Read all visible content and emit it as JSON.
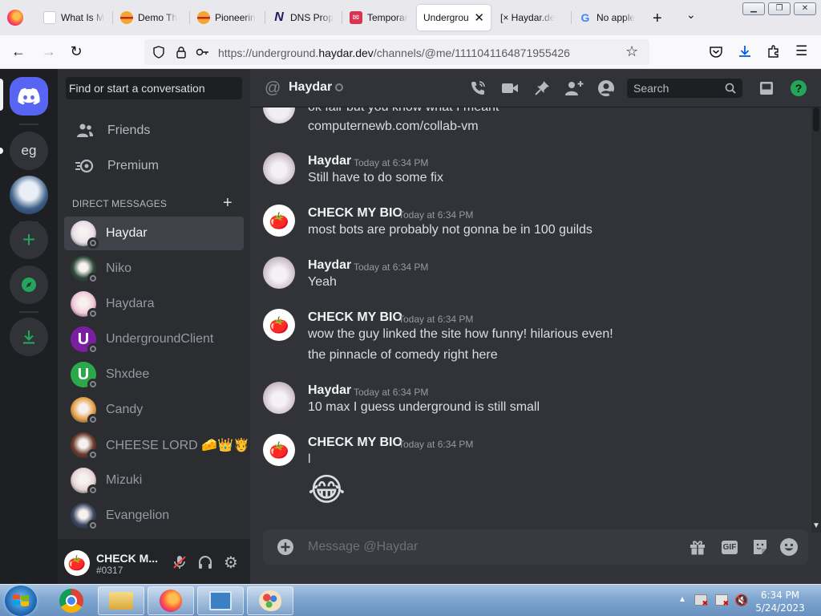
{
  "browser": {
    "tabs": [
      {
        "label": "What Is My IP",
        "favicon": "globe-icon"
      },
      {
        "label": "Demo Th",
        "favicon": "burger-icon"
      },
      {
        "label": "Pioneerin",
        "favicon": "burger-icon"
      },
      {
        "label": "DNS Prop",
        "favicon": "n-logo-icon"
      },
      {
        "label": "Temporar",
        "favicon": "mail-icon"
      },
      {
        "label": "Undergrou",
        "favicon": "discord-icon",
        "active": true
      },
      {
        "label": "[× Haydar.de",
        "favicon": "none"
      },
      {
        "label": "No apple",
        "favicon": "google-icon"
      }
    ],
    "url_prefix": "https://underground.",
    "url_host": "haydar.dev",
    "url_path": "/channels/@me/1111041164871955426"
  },
  "rail": {
    "server_text_icon": "eg"
  },
  "sidebar": {
    "search_placeholder": "Find or start a conversation",
    "links": [
      {
        "label": "Friends",
        "icon": "friends-icon"
      },
      {
        "label": "Premium",
        "icon": "nitro-icon"
      }
    ],
    "dm_header": "DIRECT MESSAGES",
    "dms": [
      {
        "name": "Haydar",
        "color": "#e9dfe6",
        "selected": true
      },
      {
        "name": "Niko",
        "color": "#2f4a3a"
      },
      {
        "name": "Haydara",
        "color": "#f3c9d8"
      },
      {
        "name": "UndergroundClient",
        "color": "#7a1fa2",
        "letter": "U"
      },
      {
        "name": "Shxdee",
        "color": "#2aa84a",
        "letter": "U"
      },
      {
        "name": "Candy",
        "color": "#e7a24a"
      },
      {
        "name": "CHEESE LORD 🧀👑🫅",
        "color": "#6b3a2b"
      },
      {
        "name": "Mizuki",
        "color": "#e8d6d6"
      },
      {
        "name": "Evangelion",
        "color": "#3b4660"
      }
    ],
    "user": {
      "name": "CHECK M...",
      "tag": "#0317"
    }
  },
  "chat": {
    "recipient": "Haydar",
    "search_placeholder": "Search",
    "composer_placeholder": "Message @Haydar",
    "partial_line_top": "ok fair but you know what I meant",
    "first_line": "computernewb.com/collab-vm",
    "messages": [
      {
        "author": "Haydar",
        "time": "Today at 6:34 PM",
        "lines": [
          "Still have to do some fix"
        ],
        "avatar": "haydar"
      },
      {
        "author": "CHECK MY BIO",
        "time": "Today at 6:34 PM",
        "lines": [
          "most bots are probably not gonna be in 100 guilds"
        ],
        "avatar": "bio"
      },
      {
        "author": "Haydar",
        "time": "Today at 6:34 PM",
        "lines": [
          "Yeah"
        ],
        "avatar": "haydar"
      },
      {
        "author": "CHECK MY BIO",
        "time": "Today at 6:34 PM",
        "lines": [
          "wow the guy linked the site how funny! hilarious even!",
          "the pinnacle of comedy right here"
        ],
        "avatar": "bio"
      },
      {
        "author": "Haydar",
        "time": "Today at 6:34 PM",
        "lines": [
          "10 max I guess underground is still small"
        ],
        "avatar": "haydar"
      },
      {
        "author": "CHECK MY BIO",
        "time": "Today at 6:34 PM",
        "lines": [
          "l"
        ],
        "avatar": "bio",
        "emoji": "😂"
      }
    ]
  },
  "taskbar": {
    "time": "6:34 PM",
    "date": "5/24/2023"
  },
  "colors": {
    "discord_blurple": "#5865f2",
    "add_server_green": "#23a55a",
    "help_green": "#23a55a"
  }
}
